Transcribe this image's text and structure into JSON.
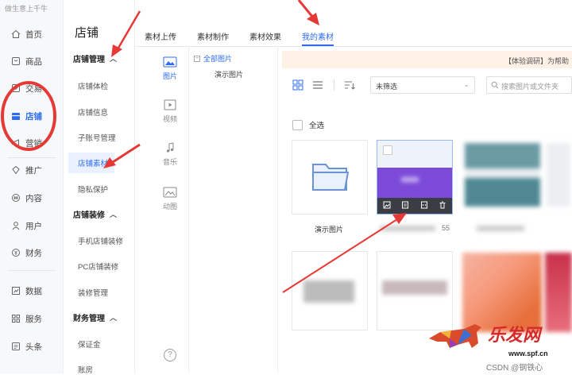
{
  "slogan": "做生意上千牛",
  "nav": {
    "items": [
      {
        "label": "首页",
        "icon": "home-icon"
      },
      {
        "label": "商品",
        "icon": "goods-icon"
      },
      {
        "label": "交易",
        "icon": "trade-icon"
      },
      {
        "label": "店铺",
        "icon": "store-icon",
        "active": true
      },
      {
        "label": "营销",
        "icon": "megaphone-icon"
      },
      {
        "label": "推广",
        "icon": "promote-icon"
      },
      {
        "label": "内容",
        "icon": "content-icon"
      },
      {
        "label": "用户",
        "icon": "user-icon"
      },
      {
        "label": "财务",
        "icon": "finance-icon"
      },
      {
        "label": "数据",
        "icon": "data-icon"
      },
      {
        "label": "服务",
        "icon": "service-icon"
      },
      {
        "label": "头条",
        "icon": "headline-icon"
      }
    ]
  },
  "subnav": {
    "title": "店铺",
    "groups": [
      {
        "label": "店铺管理",
        "items": [
          "店铺体检",
          "店铺信息",
          "子账号管理",
          "店铺素材",
          "隐私保护"
        ]
      },
      {
        "label": "店铺装修",
        "items": [
          "手机店铺装修",
          "PC店铺装修",
          "装修管理"
        ]
      },
      {
        "label": "财务管理",
        "items": [
          "保证金",
          "账房"
        ]
      }
    ],
    "active_item": "店铺素材"
  },
  "tabs": [
    "素材上传",
    "素材制作",
    "素材效果",
    "我的素材"
  ],
  "active_tab": "我的素材",
  "types": [
    {
      "label": "图片",
      "icon": "image-icon",
      "active": true
    },
    {
      "label": "视频",
      "icon": "video-icon"
    },
    {
      "label": "音乐",
      "icon": "music-icon"
    },
    {
      "label": "动图",
      "icon": "gif-icon"
    }
  ],
  "tree": {
    "root": "全部图片",
    "child": "演示图片",
    "toggle": "−"
  },
  "banner": "【体验调研】为帮助",
  "filter": {
    "value": "未筛选",
    "chevron": "⌄"
  },
  "search": {
    "placeholder": "搜索图片或文件夹"
  },
  "select_all": "全选",
  "folder_caption": "演示图片",
  "image_caption_suffix": "55",
  "help_glyph": "?",
  "watermark": {
    "logo_text": "乐发网",
    "url": "www.spf.cn",
    "csdn": "CSDN @钢铁心"
  },
  "colors": {
    "accent": "#2d6cf1",
    "annotation": "#e53935",
    "banner": "#fdf1e6"
  }
}
